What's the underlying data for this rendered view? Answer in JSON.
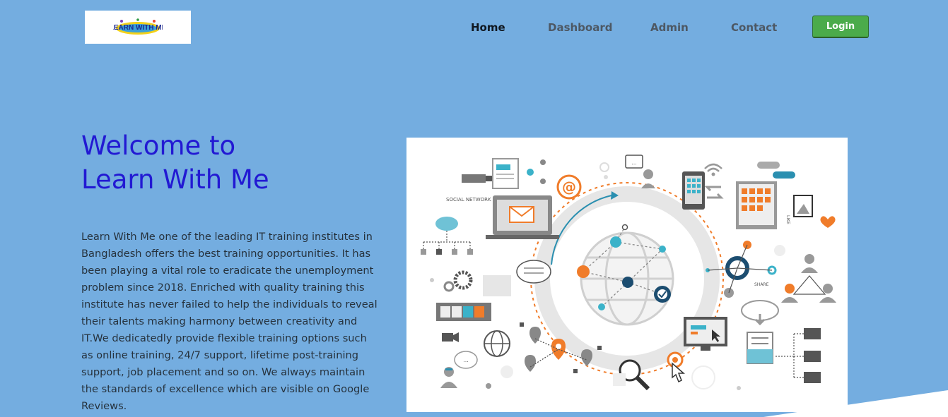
{
  "header": {
    "logo_text": "LEARN WITH ME",
    "nav": {
      "home": "Home",
      "dashboard": "Dashboard",
      "admin": "Admin",
      "contact": "Contact"
    },
    "login_label": "Login"
  },
  "hero": {
    "title_line1": "Welcome to",
    "title_line2": "Learn With Me",
    "description": "Learn With Me one of the leading IT training institutes in Bangladesh offers the best training opportunities. It has been playing a vital role to eradicate the unemployment problem since 2018. Enriched with quality training this institute has never failed to help the individuals to reveal their talents making harmony between creativity and IT.We dedicatedly provide flexible training options such as online training, 24/7 support, lifetime post-training support, job placement and so on. We always maintain the standards of excellence which are visible on Google Reviews."
  },
  "illustration": {
    "social_network_label": "SOCIAL NETWORK",
    "share_label": "SHARE",
    "like_label": "LIKE",
    "email_symbol": "@"
  },
  "colors": {
    "background": "#74ade0",
    "title": "#2219d3",
    "login_button": "#4bab4b",
    "accent_orange": "#f07c2a",
    "accent_teal": "#2a8fb0"
  }
}
